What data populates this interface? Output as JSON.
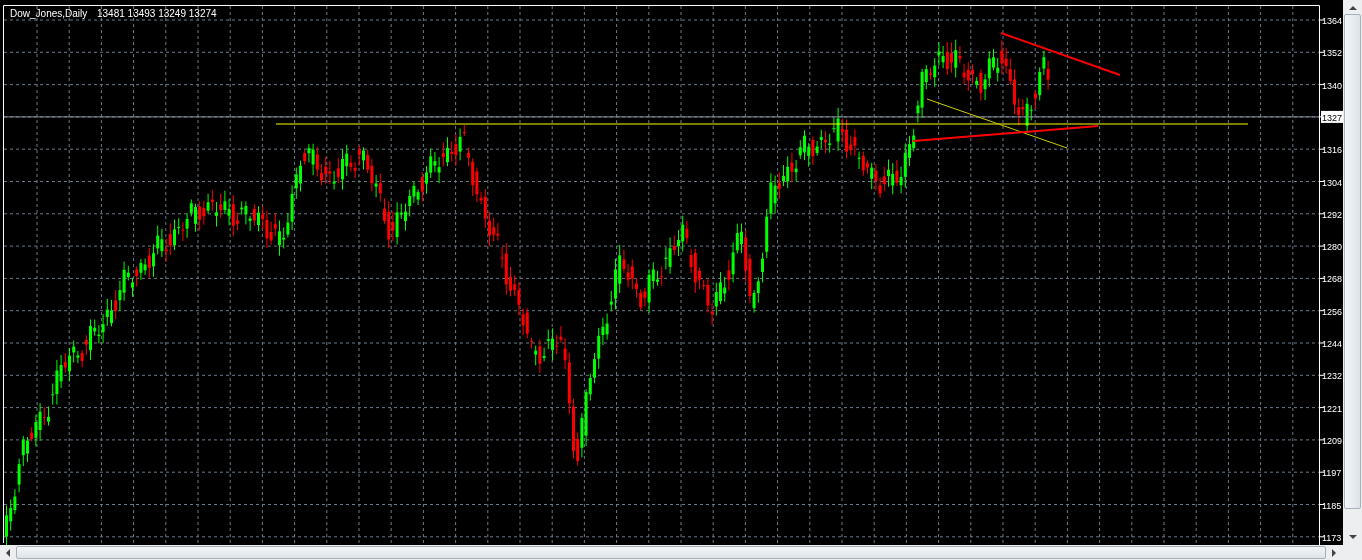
{
  "chart": {
    "symbol": "Dow_Jones,Daily",
    "quote": "13481 13493 13249 13274"
  },
  "price_axis": {
    "labels": [
      {
        "text": "1364",
        "highlighted": false
      },
      {
        "text": "1352",
        "highlighted": false
      },
      {
        "text": "1340",
        "highlighted": false
      },
      {
        "text": "1327",
        "highlighted": true
      },
      {
        "text": "1316",
        "highlighted": false
      },
      {
        "text": "1304",
        "highlighted": false
      },
      {
        "text": "1292",
        "highlighted": false
      },
      {
        "text": "1280",
        "highlighted": false
      },
      {
        "text": "1268",
        "highlighted": false
      },
      {
        "text": "1256",
        "highlighted": false
      },
      {
        "text": "1244",
        "highlighted": false
      },
      {
        "text": "1232",
        "highlighted": false
      },
      {
        "text": "1221",
        "highlighted": false
      },
      {
        "text": "1209",
        "highlighted": false
      },
      {
        "text": "1197",
        "highlighted": false
      },
      {
        "text": "1185",
        "highlighted": false
      },
      {
        "text": "1173",
        "highlighted": false
      }
    ]
  }
}
